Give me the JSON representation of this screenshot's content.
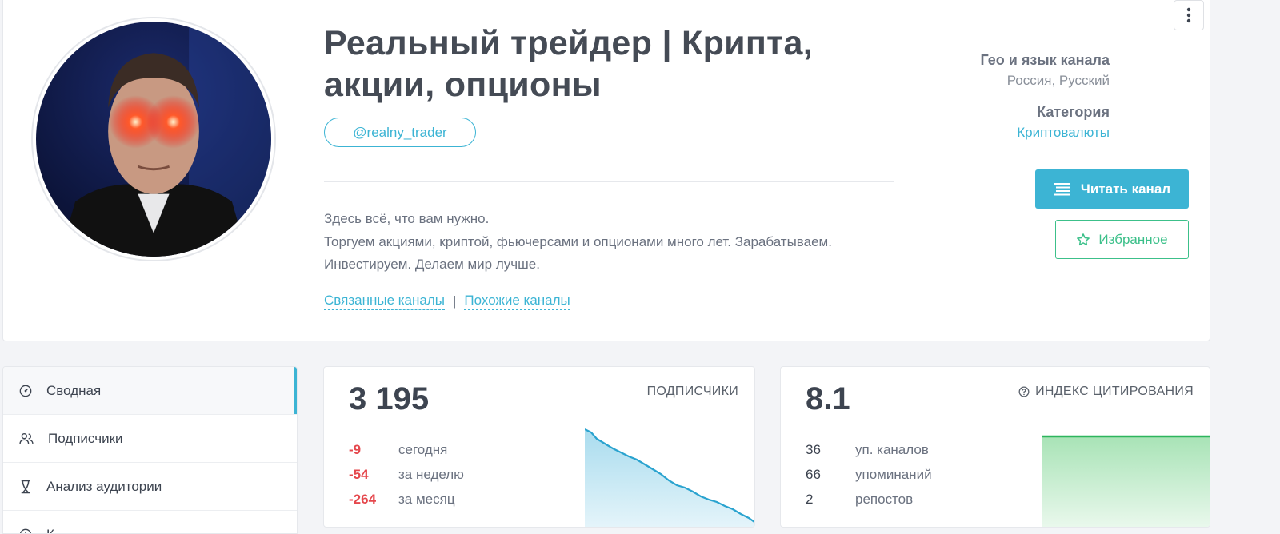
{
  "channel": {
    "title": "Реальный трейдер | Крипта, акции, опционы",
    "handle": "@realny_trader",
    "description": [
      "Здесь всё, что вам нужно.",
      "Торгуем акциями, криптой, фьючерсами и опционами много лет. Зарабатываем.",
      "Инвестируем. Делаем мир лучше."
    ],
    "links": {
      "related": "Связанные каналы",
      "separator": "|",
      "similar": "Похожие каналы"
    },
    "geo_label": "Гео и язык канала",
    "geo_value": "Россия, Русский",
    "category_label": "Категория",
    "category_value": "Криптовалюты",
    "read_button": "Читать канал",
    "favorite_button": "Избранное"
  },
  "sidebar": {
    "items": [
      {
        "label": "Сводная",
        "icon": "dashboard-icon",
        "active": true
      },
      {
        "label": "Подписчики",
        "icon": "users-icon"
      },
      {
        "label": "Анализ аудитории",
        "icon": "dna-icon"
      },
      {
        "label": "К",
        "icon": "clock-icon"
      }
    ]
  },
  "subscribers": {
    "label": "ПОДПИСЧИКИ",
    "total": "3 195",
    "rows": [
      {
        "value": "-9",
        "label": "сегодня"
      },
      {
        "value": "-54",
        "label": "за неделю"
      },
      {
        "value": "-264",
        "label": "за месяц"
      }
    ]
  },
  "citation": {
    "label": "ИНДЕКС ЦИТИРОВАНИЯ",
    "value": "8.1",
    "rows": [
      {
        "value": "36",
        "label": "уп. каналов"
      },
      {
        "value": "66",
        "label": "упоминаний"
      },
      {
        "value": "2",
        "label": "репостов"
      }
    ]
  },
  "colors": {
    "accent": "#3cb4d4",
    "favorite": "#3cc08a",
    "negative": "#e5484d",
    "sparkline_green": "#2db55d"
  }
}
